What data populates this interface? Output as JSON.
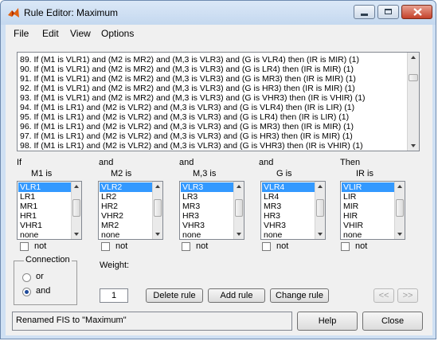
{
  "window": {
    "title": "Rule Editor: Maximum"
  },
  "menu": [
    "File",
    "Edit",
    "View",
    "Options"
  ],
  "rules": [
    "89. If (M1 is VLR1) and (M2 is MR2) and (M,3 is VLR3) and (G is VLR4) then (IR is MIR) (1)",
    "90. If (M1 is VLR1) and (M2 is MR2) and (M,3 is VLR3) and (G is LR4) then (IR is MIR) (1)",
    "91. If (M1 is VLR1) and (M2 is MR2) and (M,3 is VLR3) and (G is MR3) then (IR is MIR) (1)",
    "92. If (M1 is VLR1) and (M2 is MR2) and (M,3 is VLR3) and (G is HR3) then (IR is MIR) (1)",
    "93. If (M1 is VLR1) and (M2 is MR2) and (M,3 is VLR3) and (G is VHR3) then (IR is VHIR) (1)",
    "94. If (M1 is LR1) and (M2 is VLR2) and (M,3 is VLR3) and (G is VLR4) then (IR is LIR) (1)",
    "95. If (M1 is LR1) and (M2 is VLR2) and (M,3 is VLR3) and (G is LR4) then (IR is LIR) (1)",
    "96. If (M1 is LR1) and (M2 is VLR2) and (M,3 is VLR3) and (G is MR3) then (IR is MIR) (1)",
    "97. If (M1 is LR1) and (M2 is VLR2) and (M,3 is VLR3) and (G is HR3) then (IR is MIR) (1)",
    "98. If (M1 is LR1) and (M2 is VLR2) and (M,3 is VLR3) and (G is VHR3) then (IR is VHIR) (1)"
  ],
  "columns": [
    {
      "prefix": "If",
      "var": "M1 is",
      "items": [
        "VLR1",
        "LR1",
        "MR1",
        "HR1",
        "VHR1",
        "none"
      ],
      "selected": 0,
      "not_label": "not"
    },
    {
      "prefix": "and",
      "var": "M2 is",
      "items": [
        "VLR2",
        "LR2",
        "HR2",
        "VHR2",
        "MR2",
        "none"
      ],
      "selected": 0,
      "not_label": "not"
    },
    {
      "prefix": "and",
      "var": "M,3 is",
      "items": [
        "VLR3",
        "LR3",
        "MR3",
        "HR3",
        "VHR3",
        "none"
      ],
      "selected": 0,
      "not_label": "not"
    },
    {
      "prefix": "and",
      "var": "G is",
      "items": [
        "VLR4",
        "LR4",
        "MR3",
        "HR3",
        "VHR3",
        "none"
      ],
      "selected": 0,
      "not_label": "not"
    },
    {
      "prefix": "Then",
      "var": "IR is",
      "items": [
        "VLIR",
        "LIR",
        "MIR",
        "HIR",
        "VHIR",
        "none"
      ],
      "selected": 0,
      "not_label": "not"
    }
  ],
  "connection": {
    "title": "Connection",
    "options": [
      "or",
      "and"
    ],
    "selected": "and"
  },
  "weight": {
    "label": "Weight:",
    "value": "1"
  },
  "buttons": {
    "delete": "Delete rule",
    "add": "Add rule",
    "change": "Change rule",
    "prev": "<<",
    "next": ">>"
  },
  "status": "Renamed FIS to \"Maximum\"",
  "bottom_buttons": {
    "help": "Help",
    "close": "Close"
  }
}
